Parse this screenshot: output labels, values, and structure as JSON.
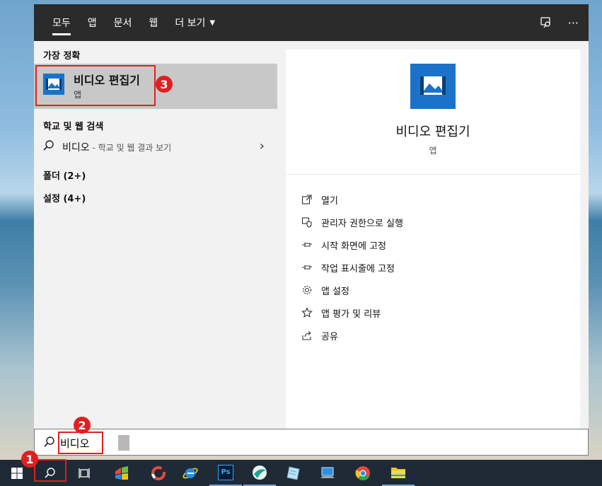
{
  "tabs": [
    {
      "label": "모두"
    },
    {
      "label": "앱"
    },
    {
      "label": "문서"
    },
    {
      "label": "웹"
    },
    {
      "label": "더 보기"
    }
  ],
  "top_icons": {
    "feedback": "feedback-icon",
    "more": "···"
  },
  "left": {
    "best_match_header": "가장 정확",
    "best_match": {
      "title": "비디오 편집기",
      "subtitle": "앱"
    },
    "web_search_header": "학교 및 웹 검색",
    "web_search": {
      "query": "비디오",
      "hint": " - 학교 및 웹 결과 보기"
    },
    "folders": "폴더 (2+)",
    "settings": "설정 (4+)"
  },
  "right": {
    "app_name": "비디오 편집기",
    "app_type": "앱",
    "actions": [
      {
        "label": "열기",
        "icon": "open-icon"
      },
      {
        "label": "관리자 권한으로 실행",
        "icon": "shield-icon"
      },
      {
        "label": "시작 화면에 고정",
        "icon": "pin-icon"
      },
      {
        "label": "작업 표시줄에 고정",
        "icon": "pin-icon"
      },
      {
        "label": "앱 설정",
        "icon": "gear-icon"
      },
      {
        "label": "앱 평가 및 리뷰",
        "icon": "star-icon"
      },
      {
        "label": "공유",
        "icon": "share-icon"
      }
    ]
  },
  "search": {
    "value": "비디오"
  },
  "taskbar": {
    "ps_label": "Ps"
  },
  "annotations": [
    "1",
    "2",
    "3"
  ],
  "colors": {
    "accent": "#1a73c8",
    "annotation": "#e02020"
  }
}
